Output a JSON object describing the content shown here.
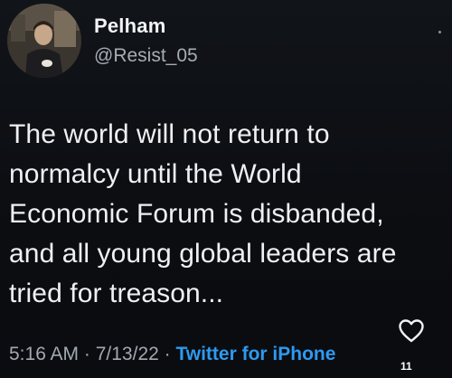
{
  "author": {
    "display_name": "Pelham",
    "handle": "@Resist_05",
    "avatar_icon": "profile-photo"
  },
  "tweet": {
    "lines": [
      "The world will not return to",
      "normalcy until the World",
      "Economic Forum is disbanded,",
      "and all young global leaders are",
      "tried for treason..."
    ]
  },
  "meta": {
    "time": "5:16 AM",
    "sep1": " · ",
    "date": "7/13/22",
    "sep2": " · ",
    "source": "Twitter for iPhone"
  },
  "actions": {
    "like_icon": "heart-outline-icon",
    "like_count": "11"
  },
  "colors": {
    "background": "#0c0e12",
    "text": "#eef0f2",
    "secondary": "#a3a9b0",
    "link": "#2d9af0"
  }
}
